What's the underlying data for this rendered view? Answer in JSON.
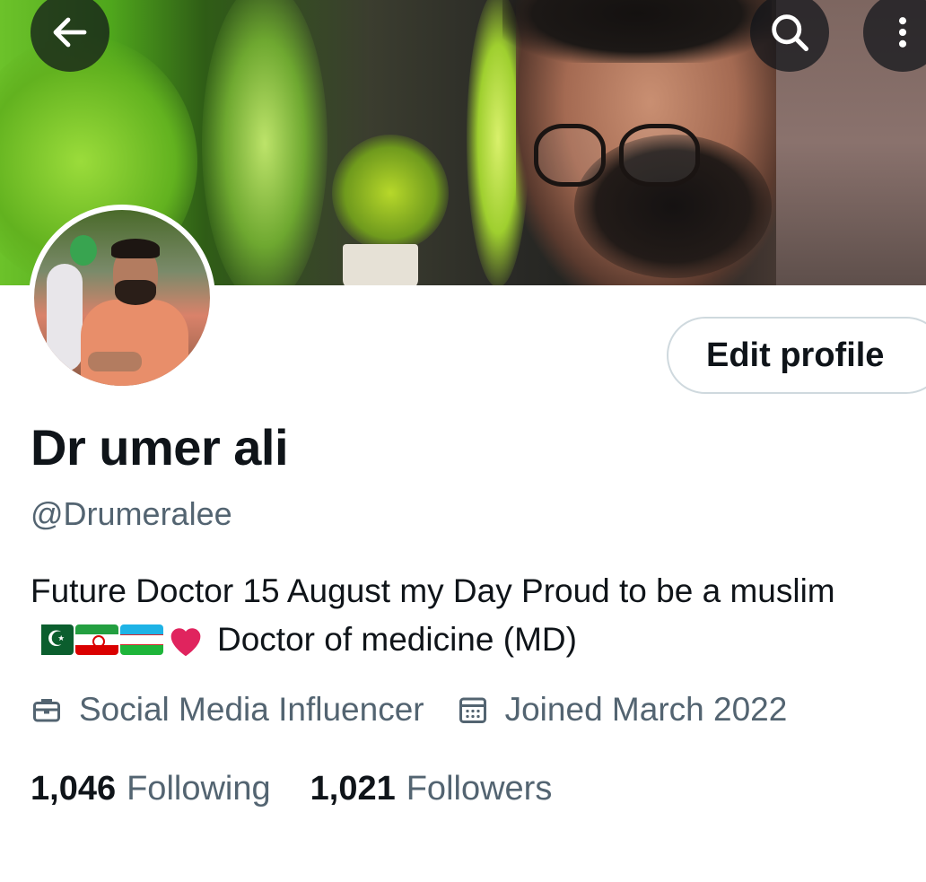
{
  "header": {
    "back_icon": "arrow-left-icon",
    "search_icon": "search-icon",
    "more_icon": "more-vertical-icon"
  },
  "profile": {
    "name": "Dr umer ali",
    "handle": "@Drumeralee",
    "edit_button_label": "Edit profile",
    "bio_line1": "Future Doctor 15 August my Day Proud to be a muslim",
    "bio_line2_emoji": [
      "flag-pakistan",
      "flag-iran",
      "flag-uzbekistan",
      "red-heart"
    ],
    "bio_line2_text": "Doctor of medicine (MD)",
    "category": "Social Media Influencer",
    "category_icon": "briefcase-icon",
    "joined": "Joined March 2022",
    "joined_icon": "calendar-icon"
  },
  "stats": {
    "following_count": "1,046",
    "following_label": "Following",
    "followers_count": "1,021",
    "followers_label": "Followers"
  },
  "colors": {
    "text_primary": "#0f1419",
    "text_secondary": "#536471",
    "button_border": "#cfd9de"
  }
}
